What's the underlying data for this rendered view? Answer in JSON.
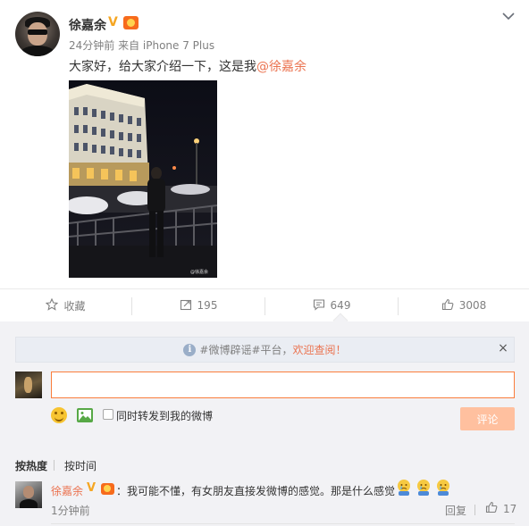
{
  "post": {
    "author": "徐嘉余",
    "verified_mark": "V",
    "meta": "24分钟前 来自 iPhone 7 Plus",
    "text": "大家好，给大家介绍一下，这是我",
    "mention": "@徐嘉余",
    "image_watermark": "@徐嘉余",
    "icons": {
      "verified": "verified-v-icon",
      "level": "level-badge-icon",
      "menu": "chevron-down-icon"
    }
  },
  "actions": [
    {
      "label": "收藏",
      "icon": "star-icon"
    },
    {
      "label": "195",
      "icon": "repost-icon"
    },
    {
      "label": "649",
      "icon": "comment-icon"
    },
    {
      "label": "3008",
      "icon": "like-icon"
    }
  ],
  "comments": {
    "notice": {
      "prefix": "#微博辟谣#平台，",
      "highlight": "欢迎查阅！",
      "close": "×",
      "info": "i"
    },
    "input": {
      "value": "",
      "placeholder": ""
    },
    "repost_label": "同时转发到我的微博",
    "submit": "评论",
    "sort": {
      "hot": "按热度",
      "time": "按时间"
    },
    "list": [
      {
        "author": "徐嘉余",
        "verified_mark": "V",
        "text": "：我可能不懂，有女朋友直接发微博的感觉。那是什么感觉",
        "time": "1分钟前",
        "reply": "回复",
        "likes": "17",
        "emoji_count": 3
      }
    ]
  },
  "colors": {
    "accent": "#eb7350",
    "verified": "#f5a623",
    "submit_disabled": "#ffc09f",
    "panel_bg": "#f2f2f5"
  }
}
